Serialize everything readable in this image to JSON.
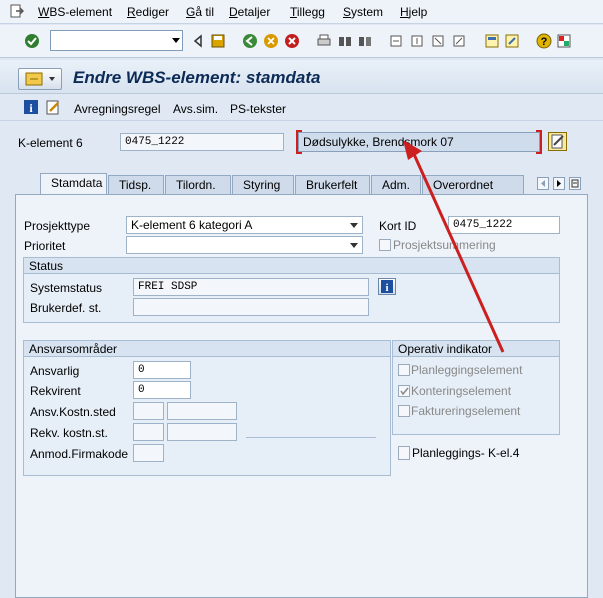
{
  "menubar": {
    "items": [
      "WBS-element",
      "Rediger",
      "Gå til",
      "Detaljer",
      "Tillegg",
      "System",
      "Hjelp"
    ]
  },
  "toolbar": {
    "command_value": "",
    "icons": [
      "check-icon",
      "back-icon",
      "save-icon",
      "back-green-icon",
      "exit-icon",
      "cancel-icon",
      "print-icon",
      "find-icon",
      "find-next-icon",
      "first-page-icon",
      "prev-page-icon",
      "next-page-icon",
      "last-page-icon",
      "new-session-icon",
      "shortcut-icon",
      "help-icon",
      "layout-icon"
    ]
  },
  "title": "Endre WBS-element: stamdata",
  "app_toolbar": {
    "billing_rule": "Avregningsregel",
    "sett_sim": "Avs.sim.",
    "ps_text": "PS-tekster"
  },
  "header": {
    "element_label": "K-element 6",
    "element_value": "0475_1222",
    "description_value": "Dødsulykke, Brendsmork 07"
  },
  "tabs": [
    "Stamdata",
    "Tidsp.",
    "Tilordn.",
    "Styring",
    "Brukerfelt",
    "Adm.",
    "Overordnet"
  ],
  "main": {
    "project_type_label": "Prosjekttype",
    "project_type_value": "K-element 6 kategori A",
    "priority_label": "Prioritet",
    "priority_value": "",
    "short_id_label": "Kort ID",
    "short_id_value": "0475_1222",
    "project_summary_label": "Prosjektsummering",
    "project_summary_checked": false
  },
  "status": {
    "heading": "Status",
    "system_status_label": "Systemstatus",
    "system_status_value": "FREI SDSP",
    "user_status_label": "Brukerdef. st.",
    "user_status_value": ""
  },
  "responsibilities": {
    "heading": "Ansvarsområder",
    "responsible_label": "Ansvarlig",
    "responsible_value": "0",
    "requester_label": "Rekvirent",
    "requester_value": "0",
    "resp_cost_center_label": "Ansv.Kostn.sted",
    "req_cost_center_label": "Rekv. kostn.st.",
    "request_company_label": "Anmod.Firmakode"
  },
  "operative": {
    "heading": "Operativ indikator",
    "planning_label": "Planleggingselement",
    "planning_checked": false,
    "account_label": "Konteringselement",
    "account_checked": true,
    "billing_label": "Faktureringselement",
    "billing_checked": false
  },
  "planning_kel": {
    "label": "Planleggings- K-el.4",
    "checked": false
  },
  "colors": {
    "accent": "#cc1f1f",
    "title_text": "#0b2a55",
    "background": "#dfe8f3"
  }
}
